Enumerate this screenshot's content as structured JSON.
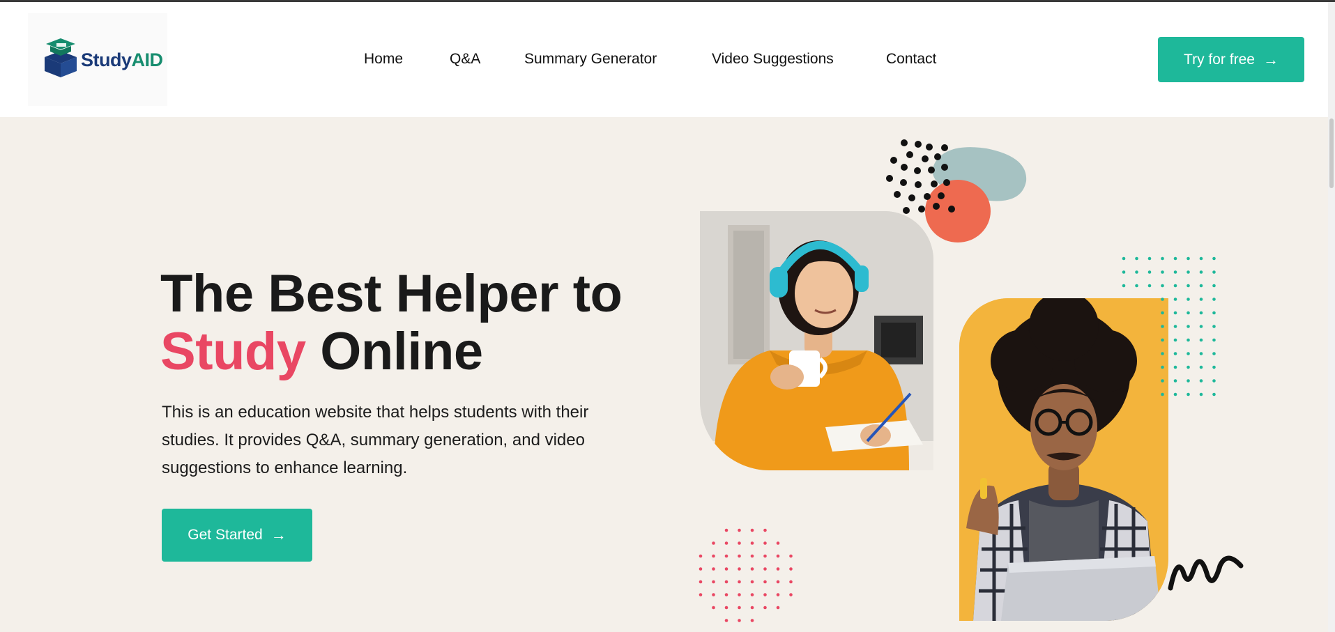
{
  "brand": {
    "name_part1": "Study",
    "name_part2": "AID",
    "colors": {
      "navy": "#1a3a78",
      "green": "#178d6f"
    }
  },
  "nav": {
    "items": [
      {
        "label": "Home"
      },
      {
        "label": "Q&A"
      },
      {
        "label": "Summary Generator"
      },
      {
        "label": "Video Suggestions"
      },
      {
        "label": "Contact"
      }
    ]
  },
  "header": {
    "cta_label": "Try for free",
    "cta_icon": "arrow-right-icon"
  },
  "hero": {
    "title_line1": "The Best Helper to",
    "title_accent": "Study",
    "title_rest": " Online",
    "description": "This is an education website that helps students with their studies. It provides Q&A, summary generation, and video suggestions to enhance learning.",
    "cta_label": "Get Started",
    "cta_icon": "arrow-right-icon"
  },
  "theme": {
    "accent": "#1eb89a",
    "highlight": "#e94763",
    "background": "#f4f0ea",
    "photo2_background": "#f3b43c",
    "blob_coral": "#ee6a50",
    "blob_sage": "#a6c2c2"
  }
}
